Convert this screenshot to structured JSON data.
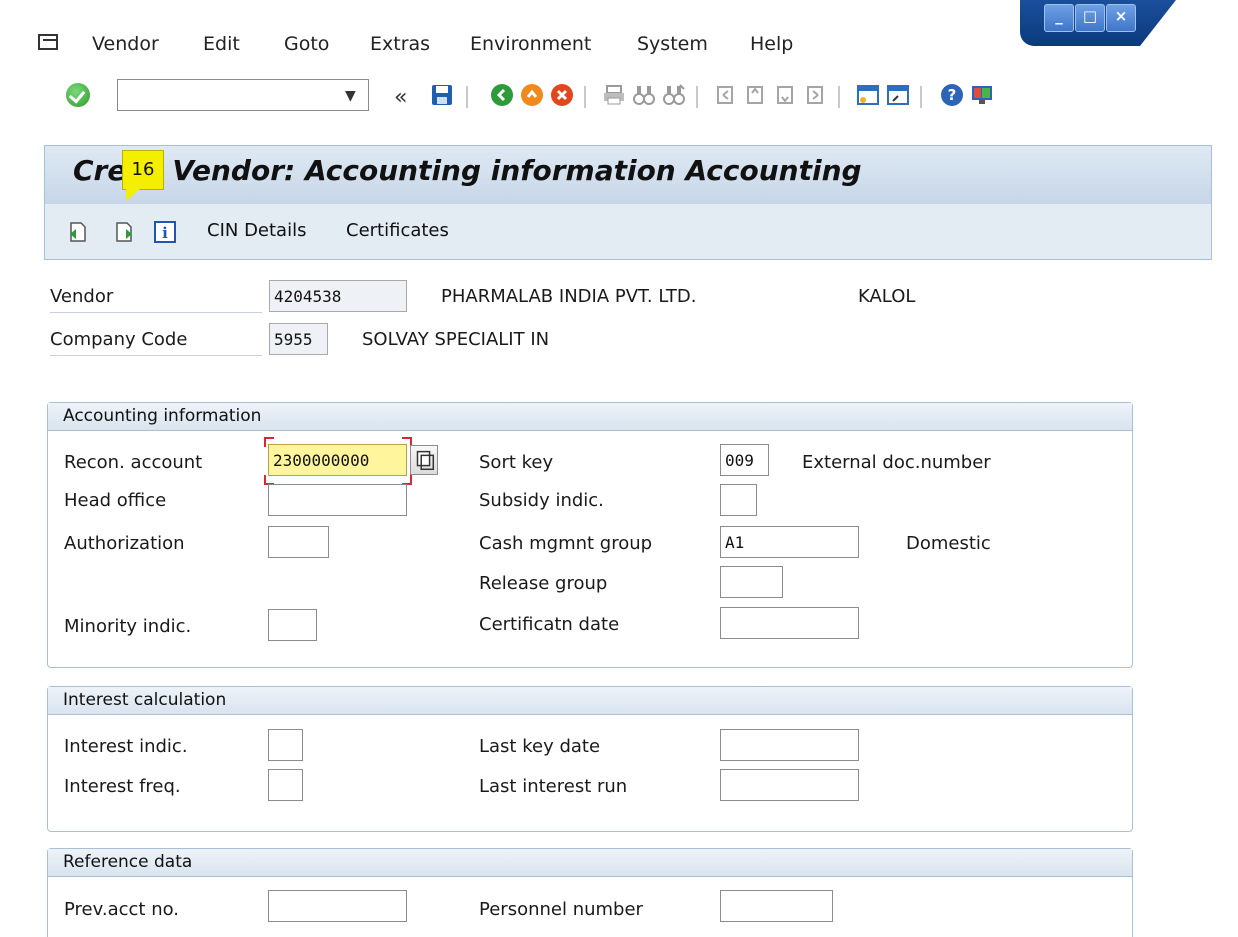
{
  "menu": {
    "items": [
      "Vendor",
      "Edit",
      "Goto",
      "Extras",
      "Environment",
      "System",
      "Help"
    ]
  },
  "toolbar": {
    "command_value": "",
    "back_double": "«"
  },
  "title": {
    "text_prefix": "Cre",
    "text_suffix": "Vendor: Accounting information Accounting",
    "badge": "16"
  },
  "app_toolbar": {
    "cin_details": "CIN Details",
    "certificates": "Certificates"
  },
  "header": {
    "vendor_label": "Vendor",
    "vendor_value": "4204538",
    "vendor_name": "PHARMALAB INDIA PVT. LTD.",
    "vendor_city": "KALOL",
    "company_label": "Company Code",
    "company_value": "5955",
    "company_name": "SOLVAY SPECIALIT IN"
  },
  "accounting": {
    "heading": "Accounting information",
    "recon_label": "Recon. account",
    "recon_value": "2300000000",
    "head_office_label": "Head office",
    "head_office_value": "",
    "authorization_label": "Authorization",
    "authorization_value": "",
    "minority_label": "Minority indic.",
    "minority_value": "",
    "sort_key_label": "Sort key",
    "sort_key_value": "009",
    "sort_key_text": "External doc.number",
    "subsidy_label": "Subsidy indic.",
    "subsidy_value": "",
    "cash_label": "Cash mgmnt group",
    "cash_value": "A1",
    "cash_text": "Domestic",
    "release_label": "Release group",
    "release_value": "",
    "cert_date_label": "Certificatn date",
    "cert_date_value": ""
  },
  "interest": {
    "heading": "Interest calculation",
    "indic_label": "Interest indic.",
    "indic_value": "",
    "freq_label": "Interest freq.",
    "freq_value": "",
    "last_key_label": "Last key date",
    "last_key_value": "",
    "last_run_label": "Last interest run",
    "last_run_value": ""
  },
  "reference": {
    "heading": "Reference data",
    "prev_acct_label": "Prev.acct no.",
    "prev_acct_value": "",
    "personnel_label": "Personnel number",
    "personnel_value": ""
  },
  "colors": {
    "title_bar": "#c6d6e7",
    "highlight_field": "#fff59d",
    "badge": "#f4ef00",
    "focus_corners": "#d8263a"
  }
}
